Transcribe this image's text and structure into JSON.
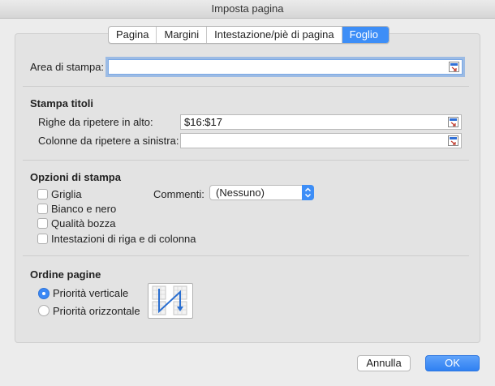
{
  "window": {
    "title": "Imposta pagina"
  },
  "tabs": [
    {
      "label": "Pagina",
      "active": false
    },
    {
      "label": "Margini",
      "active": false
    },
    {
      "label": "Intestazione/piè di pagina",
      "active": false
    },
    {
      "label": "Foglio",
      "active": true
    }
  ],
  "print_area": {
    "label": "Area di stampa:",
    "value": ""
  },
  "print_titles": {
    "heading": "Stampa titoli",
    "rows_label": "Righe da ripetere in alto:",
    "rows_value": "$16:$17",
    "cols_label": "Colonne da ripetere a sinistra:",
    "cols_value": ""
  },
  "print_options": {
    "heading": "Opzioni di stampa",
    "checkboxes": [
      {
        "label": "Griglia",
        "checked": false
      },
      {
        "label": "Bianco e nero",
        "checked": false
      },
      {
        "label": "Qualità bozza",
        "checked": false
      },
      {
        "label": "Intestazioni di riga e di colonna",
        "checked": false
      }
    ],
    "comments_label": "Commenti:",
    "comments_value": "(Nessuno)"
  },
  "page_order": {
    "heading": "Ordine pagine",
    "options": [
      {
        "label": "Priorità verticale",
        "selected": true
      },
      {
        "label": "Priorità orizzontale",
        "selected": false
      }
    ]
  },
  "buttons": {
    "cancel": "Annulla",
    "ok": "OK"
  },
  "colors": {
    "accent": "#3d8ef7",
    "panel": "#e3e3e3",
    "window": "#ececec"
  },
  "icons": {
    "range_picker": "collapse-dialog-icon",
    "page_order": "page-order-down-then-over-icon"
  }
}
